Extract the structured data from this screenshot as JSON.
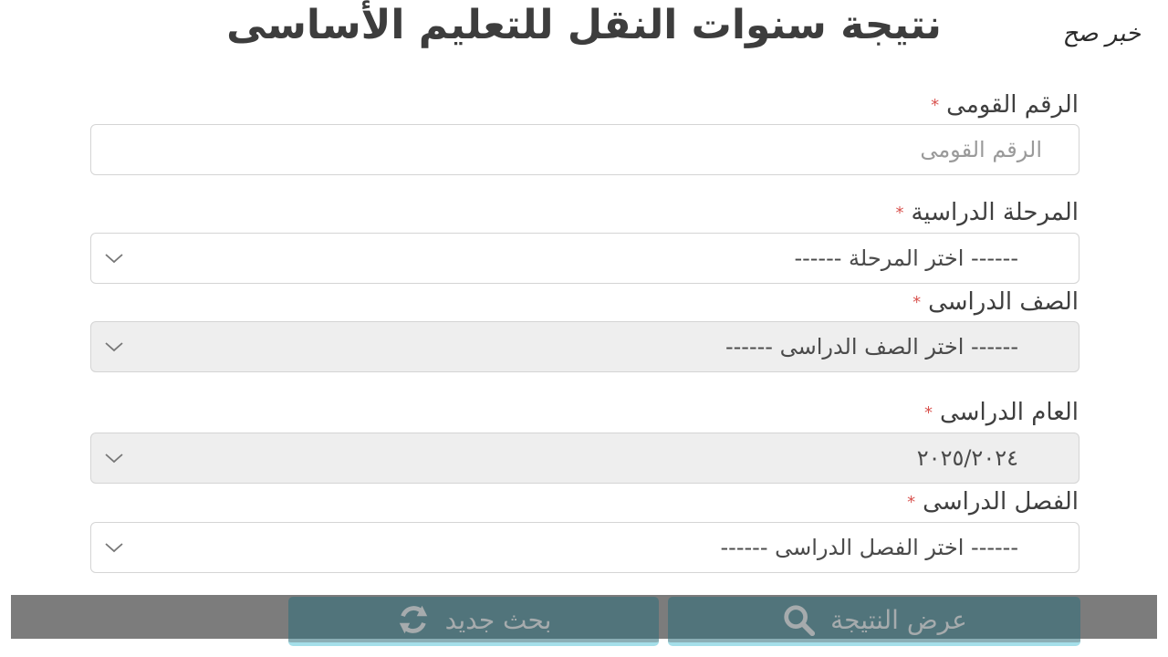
{
  "watermark": "خبر صح",
  "page": {
    "title": "نتيجة سنوات النقل للتعليم الأساسى"
  },
  "form": {
    "required_mark": "*",
    "national_id": {
      "label": "الرقم القومى",
      "placeholder": "الرقم القومى",
      "value": ""
    },
    "stage": {
      "label": "المرحلة الدراسية",
      "selected": "------ اختر المرحلة ------",
      "icon": "chevron-down-icon"
    },
    "grade": {
      "label": "الصف الدراسى",
      "selected": "------ اختر الصف الدراسى ------",
      "icon": "chevron-down-icon"
    },
    "year": {
      "label": "العام الدراسى",
      "selected": "٢٠٢٥/٢٠٢٤",
      "icon": "chevron-down-icon"
    },
    "term": {
      "label": "الفصل الدراسى",
      "selected": "------ اختر الفصل الدراسى ------",
      "icon": "chevron-down-icon"
    }
  },
  "buttons": {
    "show_result": {
      "label": "عرض النتيجة",
      "icon": "search-icon"
    },
    "new_search": {
      "label": "بحث جديد",
      "icon": "refresh-icon"
    }
  },
  "colors": {
    "button_bg": "#2e6e7b",
    "button_accent": "#5cc5d8",
    "required": "#d9534f",
    "disabled_field": "#eeeeee"
  }
}
